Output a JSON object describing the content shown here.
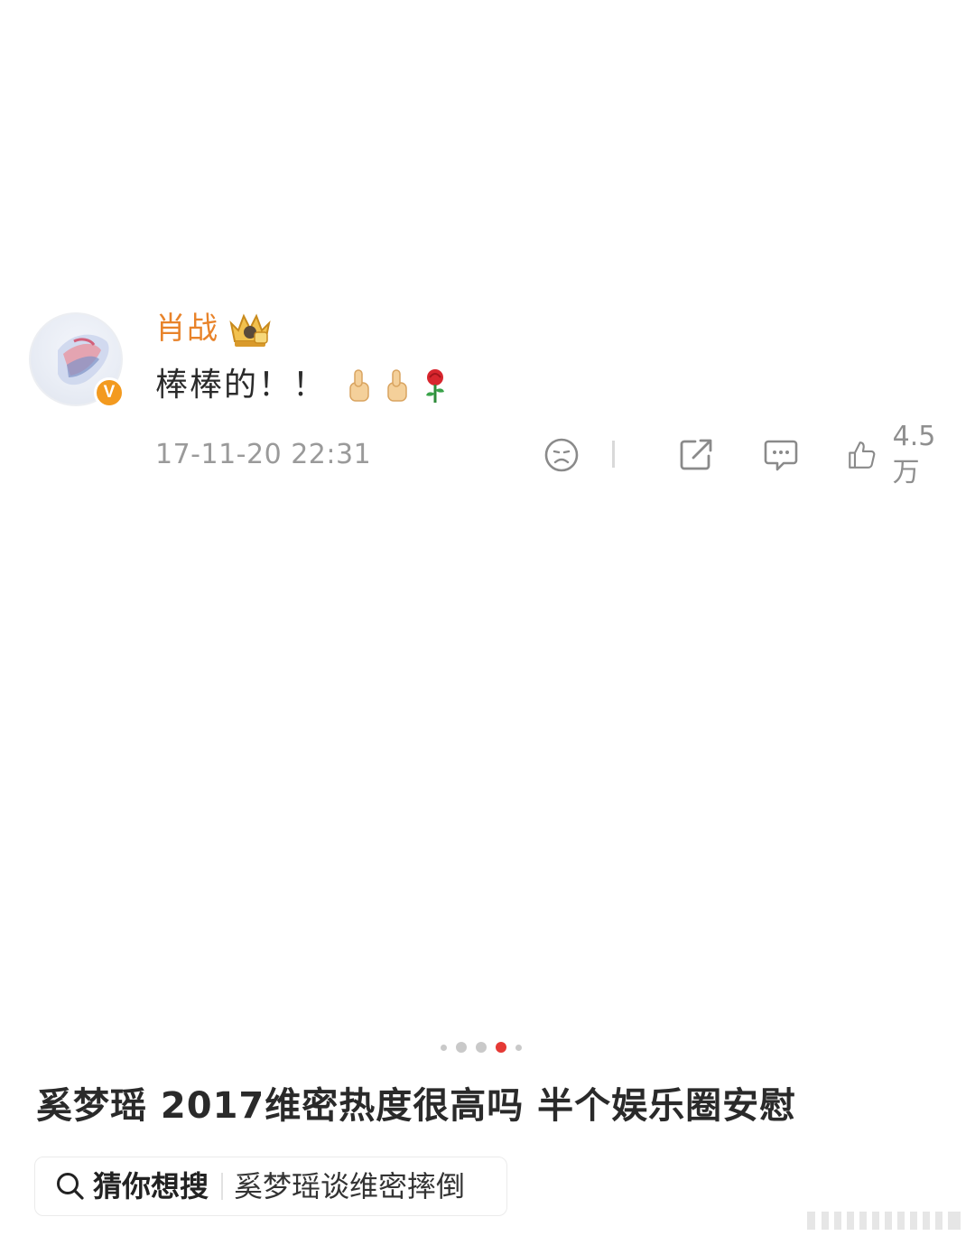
{
  "comment": {
    "username": "肖战",
    "text": "棒棒的！！",
    "emojis": [
      "thumbs-up",
      "thumbs-up",
      "rose"
    ],
    "timestamp": "17-11-20 22:31",
    "like_count": "4.5万",
    "verified_badge": "V",
    "name_color": "#e8832a",
    "badge_color": "#f39a1f"
  },
  "pager": {
    "total": 5,
    "active_index": 3,
    "active_color": "#e53935"
  },
  "headline": "奚梦瑶 2017维密热度很高吗 半个娱乐圈安慰",
  "search": {
    "label": "猜你想搜",
    "suggestion": "奚梦瑶谈维密摔倒"
  }
}
